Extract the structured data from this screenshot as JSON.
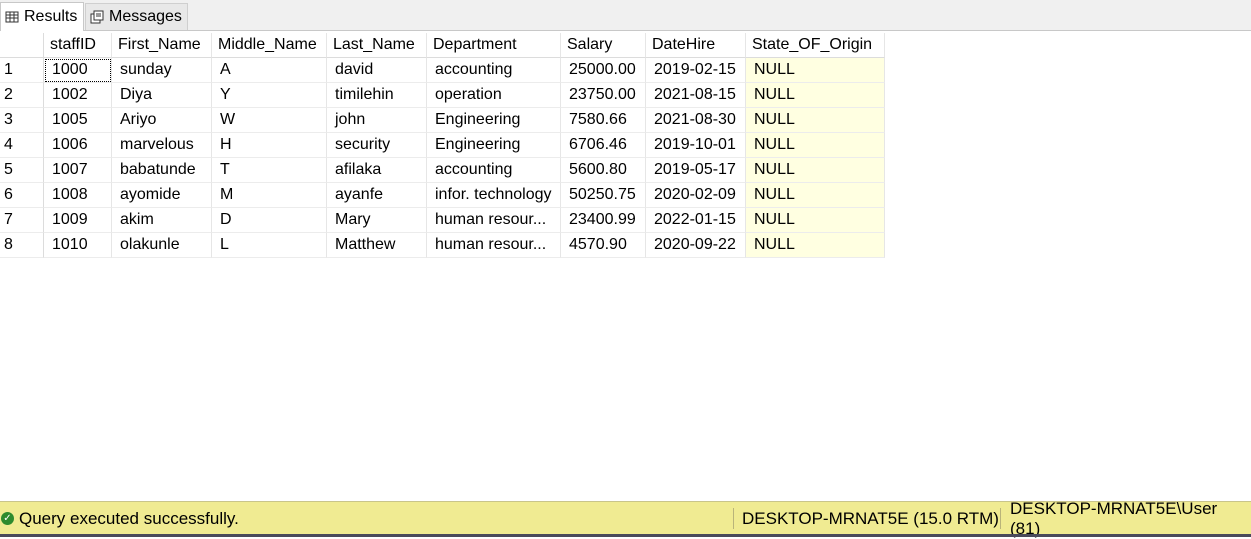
{
  "tabs": {
    "results_label": "Results",
    "messages_label": "Messages"
  },
  "grid": {
    "columns": [
      "staffID",
      "First_Name",
      "Middle_Name",
      "Last_Name",
      "Department",
      "Salary",
      "DateHire",
      "State_OF_Origin"
    ],
    "rows": [
      {
        "num": "1",
        "cells": [
          "1000",
          "sunday",
          "A",
          "david",
          "accounting",
          "25000.00",
          "2019-02-15",
          "NULL"
        ]
      },
      {
        "num": "2",
        "cells": [
          "1002",
          "Diya",
          "Y",
          "timilehin",
          "operation",
          "23750.00",
          "2021-08-15",
          "NULL"
        ]
      },
      {
        "num": "3",
        "cells": [
          "1005",
          "Ariyo",
          "W",
          "john",
          "Engineering",
          "7580.66",
          "2021-08-30",
          "NULL"
        ]
      },
      {
        "num": "4",
        "cells": [
          "1006",
          "marvelous",
          "H",
          "security",
          "Engineering",
          "6706.46",
          "2019-10-01",
          "NULL"
        ]
      },
      {
        "num": "5",
        "cells": [
          "1007",
          "babatunde",
          "T",
          "afilaka",
          "accounting",
          "5600.80",
          "2019-05-17",
          "NULL"
        ]
      },
      {
        "num": "6",
        "cells": [
          "1008",
          "ayomide",
          "M",
          "ayanfe",
          "infor. technology",
          "50250.75",
          "2020-02-09",
          "NULL"
        ]
      },
      {
        "num": "7",
        "cells": [
          "1009",
          "akim",
          "D",
          "Mary",
          "human resour...",
          "23400.99",
          "2022-01-15",
          "NULL"
        ]
      },
      {
        "num": "8",
        "cells": [
          "1010",
          "olakunle",
          "L",
          "Matthew",
          "human resour...",
          "4570.90",
          "2020-09-22",
          "NULL"
        ]
      }
    ]
  },
  "status": {
    "message": "Query executed successfully.",
    "server": "DESKTOP-MRNAT5E (15.0 RTM)",
    "user": "DESKTOP-MRNAT5E\\User (81)",
    "bar_color": "#f0eb92",
    "success_color": "#2e8b2e"
  },
  "icons": {
    "results_tab": "grid-icon",
    "messages_tab": "messages-icon",
    "status": "check-circle-icon"
  }
}
